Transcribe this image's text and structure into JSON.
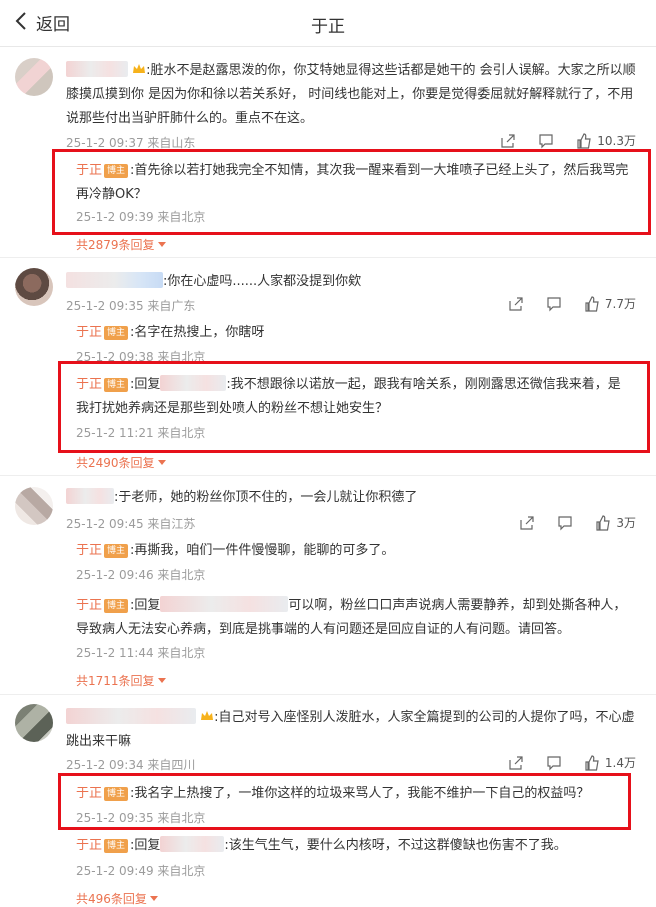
{
  "header": {
    "back_label": "返回",
    "title": "于正"
  },
  "comments": [
    {
      "text": ":脏水不是赵露思泼的你，你艾特她显得这些话都是她干的 会引人误解。大家之所以顺膝摸瓜摸到你 是因为你和徐以若关系好， 时间线也能对上，你要是觉得委屈就好解释就行了，不用说那些付出当驴肝肺什么的。重点不在这。",
      "date": "25-1-2 09:37 来自山东",
      "likes": "10.3万",
      "replies": [
        {
          "name": "于正",
          "badge": "博主",
          "text": ":首先徐以若打她我完全不知情，其次我一醒来看到一大堆喷子已经上头了，然后我骂完再冷静OK？",
          "date": "25-1-2 09:39 来自北京"
        }
      ],
      "more": "共2879条回复"
    },
    {
      "text": ":你在心虚吗......人家都没提到你欸",
      "date": "25-1-2 09:35 来自广东",
      "likes": "7.7万",
      "replies": [
        {
          "name": "于正",
          "badge": "博主",
          "text": ":名字在热搜上，你瞎呀",
          "date": "25-1-2 09:38 来自北京"
        },
        {
          "name": "于正",
          "badge": "博主",
          "prefix": ":回复",
          "text": ":我不想跟徐以诺放一起，跟我有啥关系，刚刚露思还微信我来着，是我打扰她养病还是那些到处喷人的粉丝不想让她安生？",
          "date": "25-1-2 11:21 来自北京"
        }
      ],
      "more": "共2490条回复"
    },
    {
      "text": ":于老师，她的粉丝你顶不住的，一会儿就让你积德了",
      "date": "25-1-2 09:45 来自江苏",
      "likes": "3万",
      "replies": [
        {
          "name": "于正",
          "badge": "博主",
          "text": ":再撕我，咱们一件件慢慢聊，能聊的可多了。",
          "date": "25-1-2 09:46 来自北京"
        },
        {
          "name": "于正",
          "badge": "博主",
          "prefix": ":回复",
          "text": "可以啊，粉丝口口声声说病人需要静养，却到处撕各种人，导致病人无法安心养病，到底是挑事端的人有问题还是回应自证的人有问题。请回答。",
          "date": "25-1-2 11:44 来自北京"
        }
      ],
      "more": "共1711条回复"
    },
    {
      "text": ":自己对号入座怪别人泼脏水，人家全篇提到的公司的人提你了吗，不心虚跳出来干嘛",
      "date": "25-1-2 09:34 来自四川",
      "likes": "1.4万",
      "replies": [
        {
          "name": "于正",
          "badge": "博主",
          "text": ":我名字上热搜了，一堆你这样的垃圾来骂人了，我能不维护一下自己的权益吗？",
          "date": "25-1-2 09:35 来自北京"
        },
        {
          "name": "于正",
          "badge": "博主",
          "prefix": ":回复",
          "text": ":该生气生气，要什么内核呀，不过这群傻缺也伤害不了我。",
          "date": "25-1-2 09:49 来自北京"
        }
      ],
      "more": "共496条回复"
    }
  ],
  "colors": {
    "accent": "#eb7350",
    "badge": "#f0a04b",
    "highlight": "#e6101a"
  }
}
